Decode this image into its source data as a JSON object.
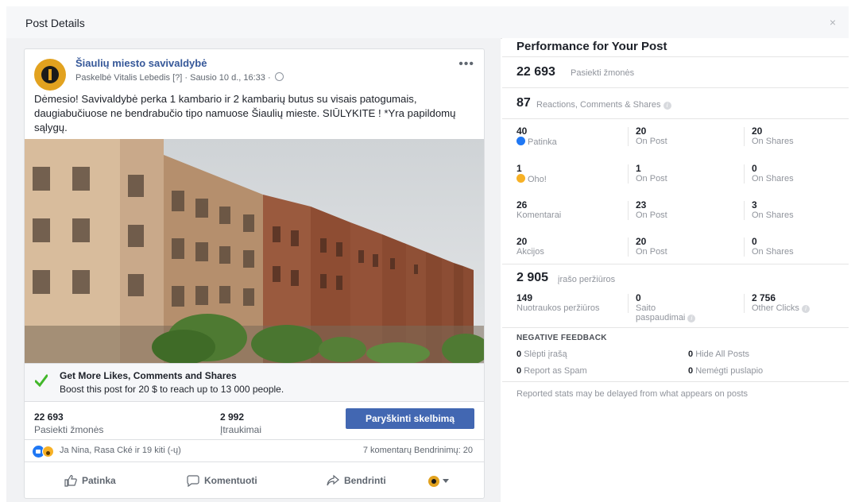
{
  "dialog": {
    "title": "Post Details",
    "close_glyph": "×"
  },
  "post": {
    "page_name": "Šiaulių miesto savivaldybė",
    "meta": "Paskelbė Vitalis Lebedis [?] · Sausio 10 d., 16:33 ·",
    "more": "•••",
    "text": "Dėmesio! Savivaldybė perka 1 kambario ir 2 kambarių butus su visais patogumais, daugiabučiuose ne bendrabučio tipo namuose Šiaulių mieste. SIŪLYKITE ! *Yra papildomų sąlygų.",
    "boost": {
      "title": "Get More Likes, Comments and Shares",
      "desc": "Boost this post for 20 $ to reach up to 13 000 people."
    },
    "stats": {
      "reached_num": "22 693",
      "reached_label": "Pasiekti žmonės",
      "engagement_num": "2 992",
      "engagement_label": "Įtraukimai",
      "boost_button": "Paryškinti skelbimą"
    },
    "reactions": {
      "names": "Ja Nina, Rasa Cké ir 19 kiti (-ų)",
      "counts": "7 komentarų  Bendrinimų: 20"
    },
    "actions": {
      "like": "Patinka",
      "comment": "Komentuoti",
      "share": "Bendrinti"
    }
  },
  "performance": {
    "title": "Performance for Your Post",
    "reached_num": "22 693",
    "reached_label": "Pasiekti žmonės",
    "rcs_num": "87",
    "rcs_label": "Reactions, Comments & Shares",
    "rows": [
      {
        "num": "40",
        "label": "Patinka",
        "post_num": "20",
        "post_label": "On Post",
        "share_num": "20",
        "share_label": "On Shares"
      },
      {
        "num": "1",
        "label": "Oho!",
        "post_num": "1",
        "post_label": "On Post",
        "share_num": "0",
        "share_label": "On Shares"
      },
      {
        "num": "26",
        "label": "Komentarai",
        "post_num": "23",
        "post_label": "On Post",
        "share_num": "3",
        "share_label": "On Shares"
      },
      {
        "num": "20",
        "label": "Akcijos",
        "post_num": "20",
        "post_label": "On Post",
        "share_num": "0",
        "share_label": "On Shares"
      }
    ],
    "views_num": "2 905",
    "views_label": "įrašo peržiūros",
    "clicks": [
      {
        "num": "149",
        "label": "Nuotraukos peržiūros"
      },
      {
        "num": "0",
        "label": "Saito",
        "label2": "paspaudimai"
      },
      {
        "num": "2 756",
        "label": "Other Clicks"
      }
    ],
    "negative": {
      "title": "NEGATIVE FEEDBACK",
      "items": [
        {
          "num": "0",
          "label": "Slėpti įrašą"
        },
        {
          "num": "0",
          "label": "Hide All Posts"
        },
        {
          "num": "0",
          "label": "Report as Spam"
        },
        {
          "num": "0",
          "label": "Nemėgti puslapio"
        }
      ]
    },
    "note": "Reported stats may be delayed from what appears on posts"
  },
  "colors": {
    "link": "#365899",
    "accent": "#4267b2",
    "like": "#2078f4",
    "boost_check": "#42b72a"
  },
  "icons": [
    "close-icon",
    "globe-icon",
    "more-icon",
    "check-icon",
    "like-reaction-icon",
    "wow-reaction-icon",
    "thumbs-up-icon",
    "comment-icon",
    "share-icon",
    "info-icon",
    "caret-down-icon"
  ]
}
